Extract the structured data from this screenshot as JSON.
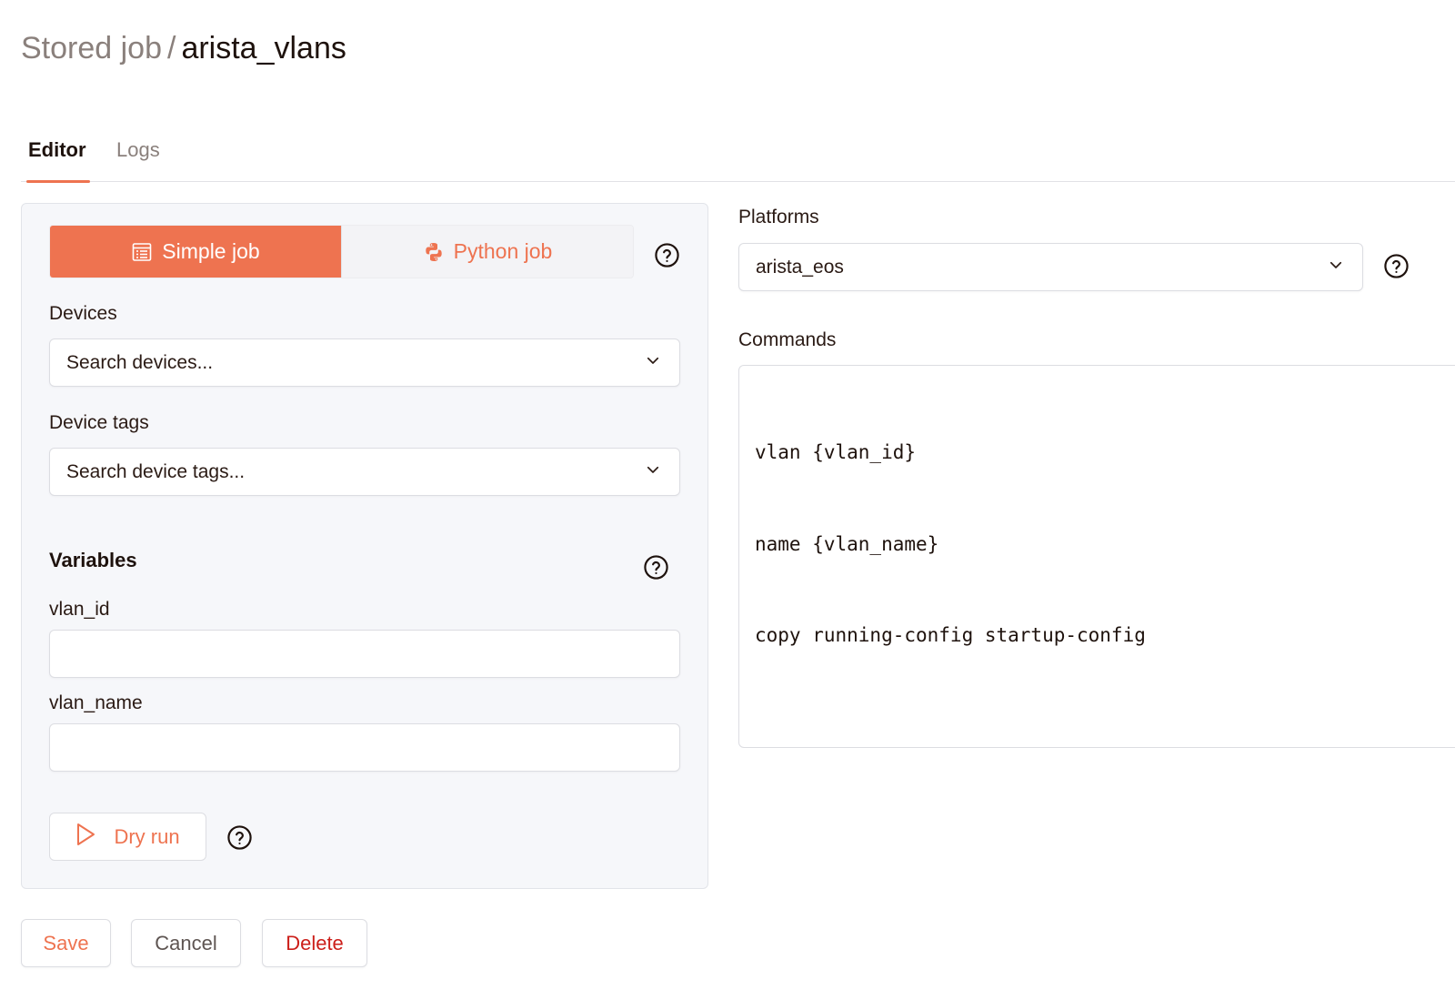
{
  "breadcrumb": {
    "parent": "Stored job",
    "separator": "/",
    "current": "arista_vlans"
  },
  "tabs": [
    {
      "label": "Editor",
      "active": true
    },
    {
      "label": "Logs",
      "active": false
    }
  ],
  "job_type": {
    "simple_label": "Simple job",
    "python_label": "Python job",
    "selected": "Simple job",
    "simple_icon": "list-document-icon",
    "python_icon": "python-icon"
  },
  "devices": {
    "label": "Devices",
    "placeholder": "Search devices..."
  },
  "device_tags": {
    "label": "Device tags",
    "placeholder": "Search device tags..."
  },
  "variables": {
    "title": "Variables",
    "fields": [
      {
        "name": "vlan_id",
        "value": ""
      },
      {
        "name": "vlan_name",
        "value": ""
      }
    ]
  },
  "dry_run": {
    "label": "Dry run",
    "icon": "play-icon"
  },
  "platforms": {
    "label": "Platforms",
    "selected": "arista_eos"
  },
  "commands": {
    "label": "Commands",
    "lines": [
      "vlan {vlan_id}",
      "name {vlan_name}",
      "copy running-config startup-config"
    ]
  },
  "actions": {
    "save": "Save",
    "cancel": "Cancel",
    "delete": "Delete"
  },
  "colors": {
    "accent": "#ee7350",
    "danger": "#cc1f1a",
    "panel_bg": "#f6f7fa"
  }
}
